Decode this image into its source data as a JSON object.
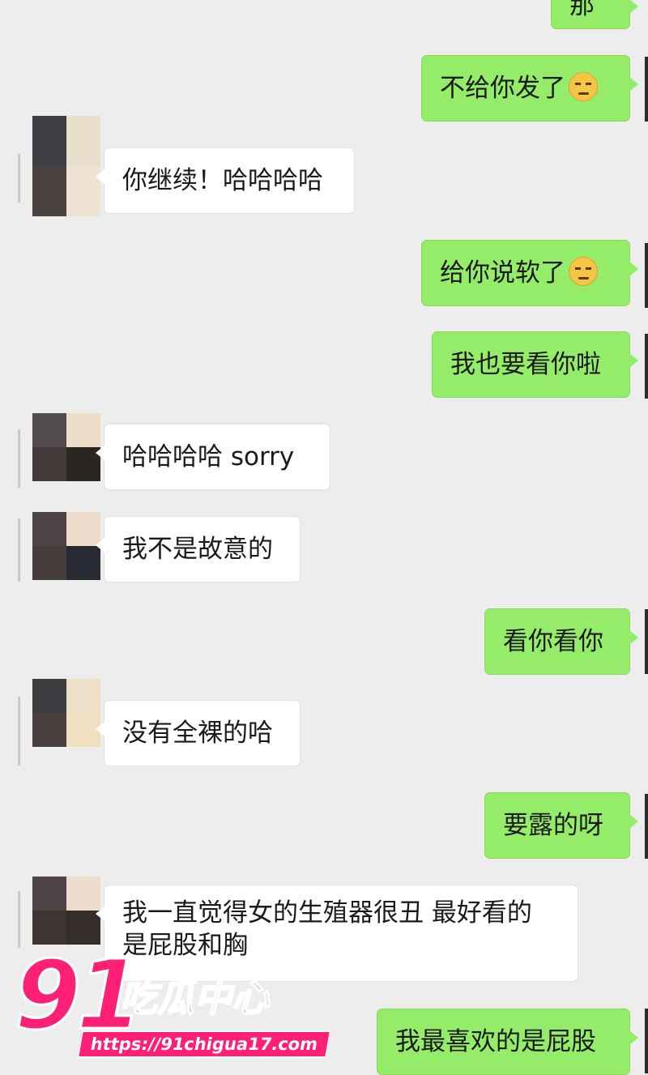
{
  "messages": [
    {
      "id": "m0",
      "side": "out",
      "text": "那"
    },
    {
      "id": "m1",
      "side": "out",
      "text": "不给你发了",
      "emoji": "unamused-face"
    },
    {
      "id": "m2",
      "side": "in",
      "text": "你继续！哈哈哈哈"
    },
    {
      "id": "m3",
      "side": "out",
      "text": "给你说软了",
      "emoji": "unamused-face"
    },
    {
      "id": "m4",
      "side": "out",
      "text": "我也要看你啦"
    },
    {
      "id": "m5",
      "side": "in",
      "text": "哈哈哈哈 sorry"
    },
    {
      "id": "m6",
      "side": "in",
      "text": "我不是故意的"
    },
    {
      "id": "m7",
      "side": "out",
      "text": "看你看你"
    },
    {
      "id": "m8",
      "side": "in",
      "text": "没有全裸的哈"
    },
    {
      "id": "m9",
      "side": "out",
      "text": "要露的呀"
    },
    {
      "id": "m10",
      "side": "in",
      "text": "我一直觉得女的生殖器很丑 最好看的是屁股和胸"
    },
    {
      "id": "m11",
      "side": "out",
      "text": "我最喜欢的是屁股"
    }
  ],
  "colors": {
    "background": "#ededed",
    "outgoing_bubble": "#95ec69",
    "incoming_bubble": "#ffffff",
    "watermark": "#ff1f74"
  },
  "watermark": {
    "number": "91",
    "title": "吃瓜中心",
    "url": "https://91chigua17.com"
  }
}
